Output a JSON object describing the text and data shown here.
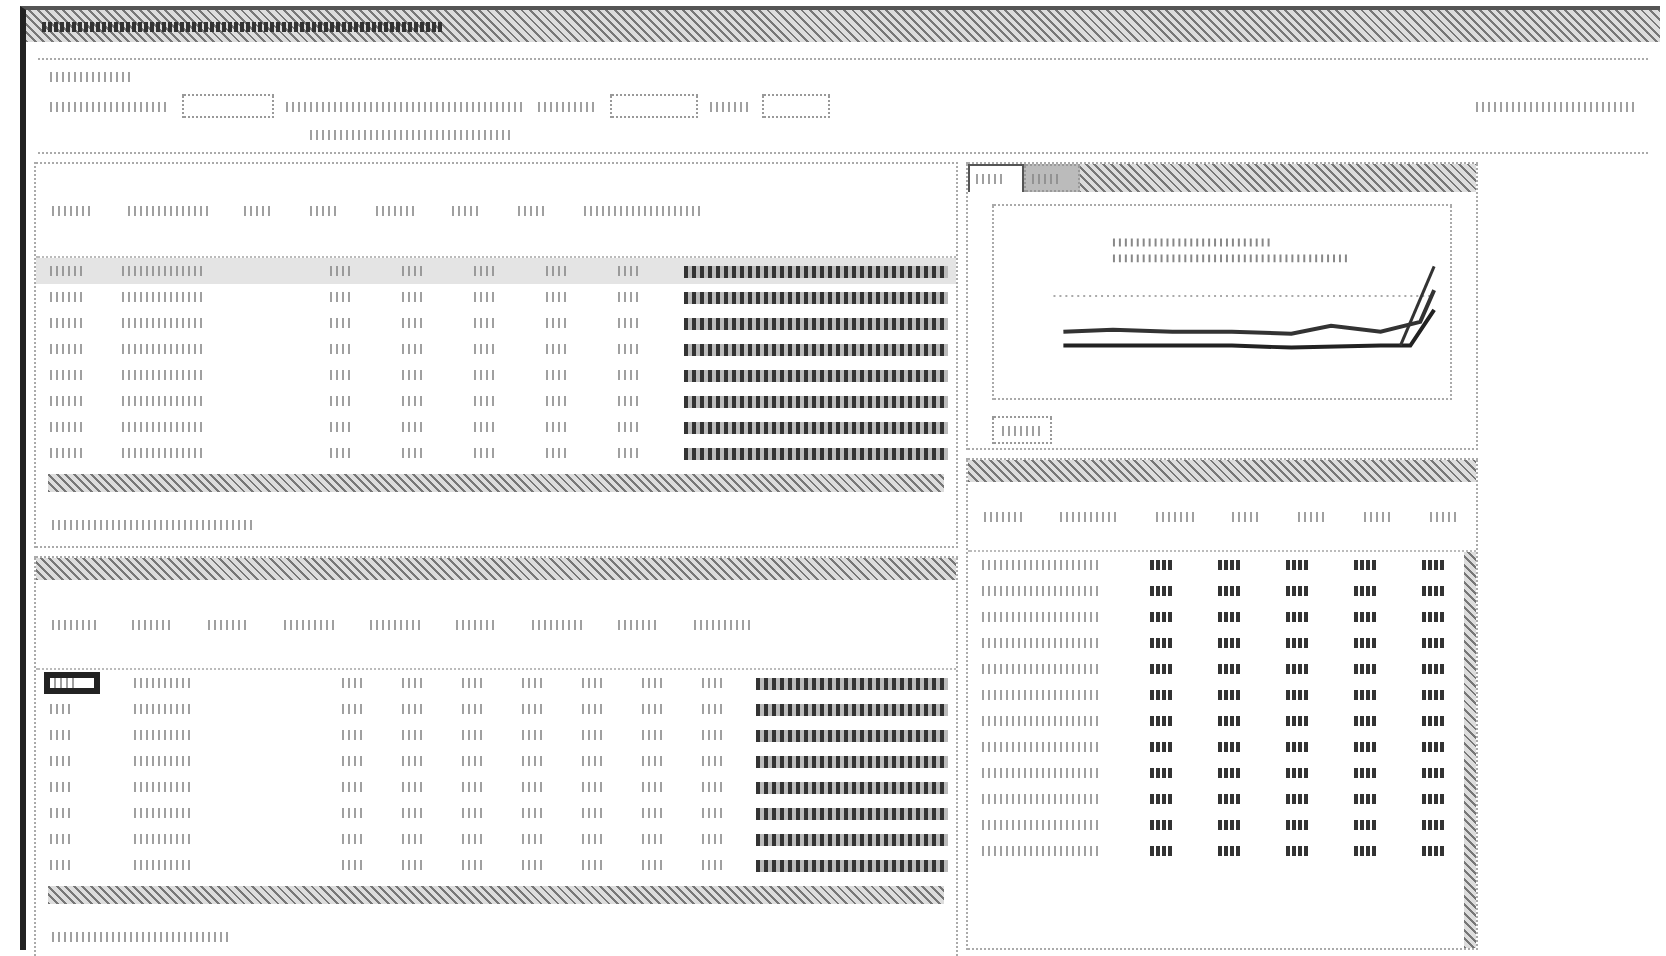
{
  "summary_table": {
    "rows": [
      {
        "highlighted": true
      },
      {
        "highlighted": false
      },
      {
        "highlighted": false
      },
      {
        "highlighted": false
      },
      {
        "highlighted": false
      },
      {
        "highlighted": false
      },
      {
        "highlighted": false
      },
      {
        "highlighted": false
      }
    ]
  },
  "chart_tabs": [
    {
      "selected": true
    },
    {
      "selected": false
    }
  ],
  "detail_table": {
    "rows": [
      {
        "focused": true
      },
      {
        "focused": false
      },
      {
        "focused": false
      },
      {
        "focused": false
      },
      {
        "focused": false
      },
      {
        "focused": false
      },
      {
        "focused": false
      },
      {
        "focused": false
      }
    ]
  }
}
